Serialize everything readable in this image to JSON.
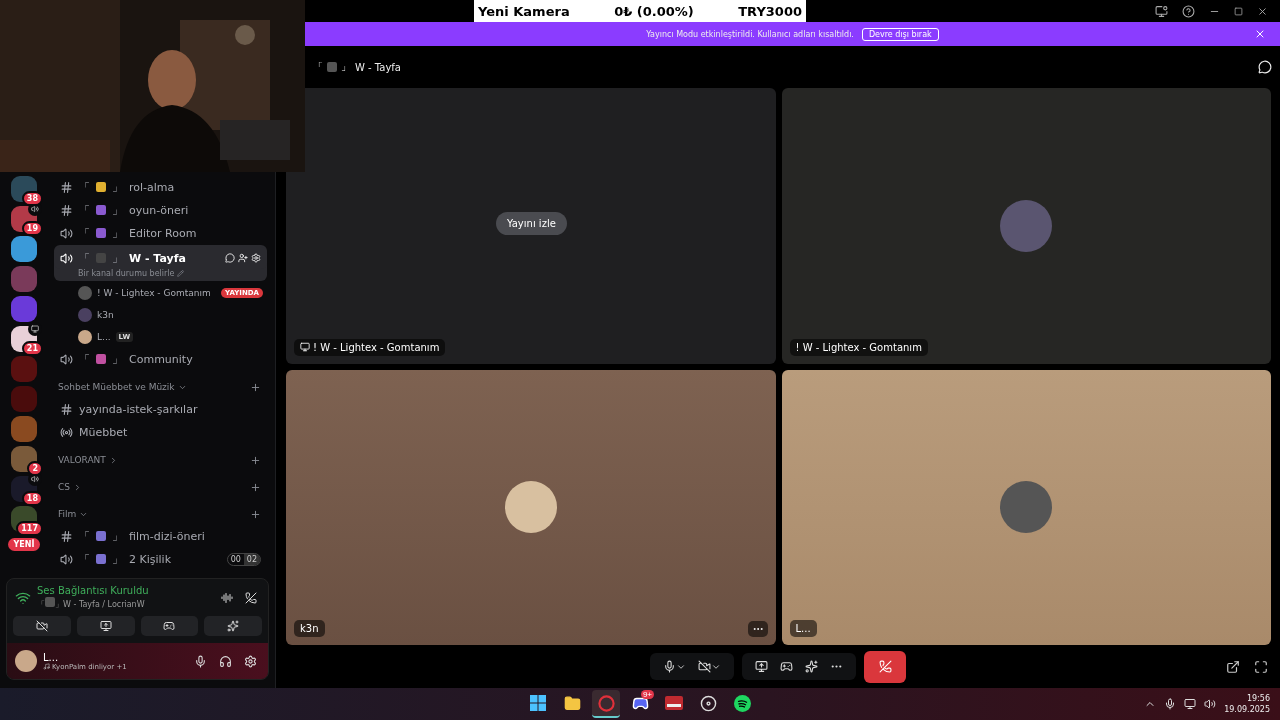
{
  "overlay": {
    "title": "Yeni Kamera",
    "change": "0₺ (0.00%)",
    "goal": "TRY3000"
  },
  "banner": {
    "text": "Yayıncı Modu etkinleştirildi. Kullanıcı adları kısaltıldı.",
    "button": "Devre dışı bırak"
  },
  "servers": [
    {
      "badge": "38",
      "voice": false,
      "screen": false
    },
    {
      "badge": "19",
      "voice": true,
      "screen": false
    },
    {
      "voice": false,
      "screen": false
    },
    {
      "voice": false,
      "screen": false
    },
    {
      "voice": false,
      "screen": false
    },
    {
      "badge": "21",
      "voice": false,
      "screen": true
    },
    {
      "voice": false,
      "screen": false
    },
    {
      "voice": false,
      "screen": false
    },
    {
      "voice": false,
      "screen": false
    },
    {
      "badge": "2",
      "voice": false,
      "screen": false
    },
    {
      "badge": "18",
      "voice": true,
      "screen": false
    },
    {
      "badge": "117",
      "pill": "YENİ",
      "voice": false,
      "screen": false
    }
  ],
  "channels": [
    {
      "kind": "text",
      "open": "「",
      "close": "」",
      "name": "rol-alma",
      "selected": false
    },
    {
      "kind": "text",
      "open": "「",
      "close": "」",
      "name": "oyun-öneri",
      "selected": false
    },
    {
      "kind": "voice",
      "open": "「",
      "close": "」",
      "name": "Editor Room",
      "selected": false
    },
    {
      "kind": "voice",
      "open": "「",
      "close": "」",
      "name": "W - Tayfa",
      "selected": true,
      "status": "Bir kanal durumu belirle",
      "children": [
        {
          "name": "! W - Lightex - Gomtanım",
          "live": "YAYINDA"
        },
        {
          "name": "k3n"
        },
        {
          "name": "L...",
          "tag": "LW"
        }
      ]
    },
    {
      "kind": "voice",
      "open": "「",
      "close": "」",
      "name": "Community",
      "selected": false
    },
    {
      "kind": "category",
      "name": "Sohbet Müebbet ve Müzik",
      "expanded": true
    },
    {
      "kind": "text",
      "name": "yayında-istek-şarkılar",
      "selected": false
    },
    {
      "kind": "stage",
      "name": "Müebbet",
      "selected": false
    },
    {
      "kind": "category",
      "name": "VALORANT",
      "expanded": false
    },
    {
      "kind": "category",
      "name": "CS",
      "expanded": false
    },
    {
      "kind": "category",
      "name": "Film",
      "expanded": true
    },
    {
      "kind": "text",
      "open": "「",
      "close": "」",
      "name": "film-dizi-öneri",
      "selected": false
    },
    {
      "kind": "voice",
      "open": "「",
      "close": "」",
      "name": "2 Kişilik",
      "selected": false,
      "counts": [
        "00",
        "02"
      ]
    }
  ],
  "voice_panel": {
    "title": "Ses Bağlantısı Kuruldu",
    "open": "「",
    "close": "」",
    "subtitle": "W - Tayfa / LocrianW"
  },
  "user_panel": {
    "name": "L...",
    "activity": "KyonPalm dinliyor",
    "extra": "+1"
  },
  "header": {
    "open": "「",
    "close": "」",
    "title": "W - Tayfa"
  },
  "tiles": [
    {
      "kind": "stream",
      "button": "Yayını izle",
      "label": "! W - Lightex - Gomtanım"
    },
    {
      "kind": "dark",
      "label": "! W - Lightex - Gomtanım"
    },
    {
      "kind": "brown",
      "label": "k3n",
      "more": true
    },
    {
      "kind": "tan",
      "label": "L...",
      "more": false
    }
  ],
  "taskbar": {
    "apps": [
      {
        "kind": "windows",
        "selected": false
      },
      {
        "kind": "folder",
        "selected": false
      },
      {
        "kind": "browser",
        "selected": true
      },
      {
        "kind": "chat",
        "selected": false,
        "badge": "9+"
      },
      {
        "kind": "mixer",
        "selected": false
      },
      {
        "kind": "recorder",
        "selected": false
      },
      {
        "kind": "music",
        "selected": false
      }
    ],
    "time": "19:56",
    "date": "19.09.2025"
  }
}
